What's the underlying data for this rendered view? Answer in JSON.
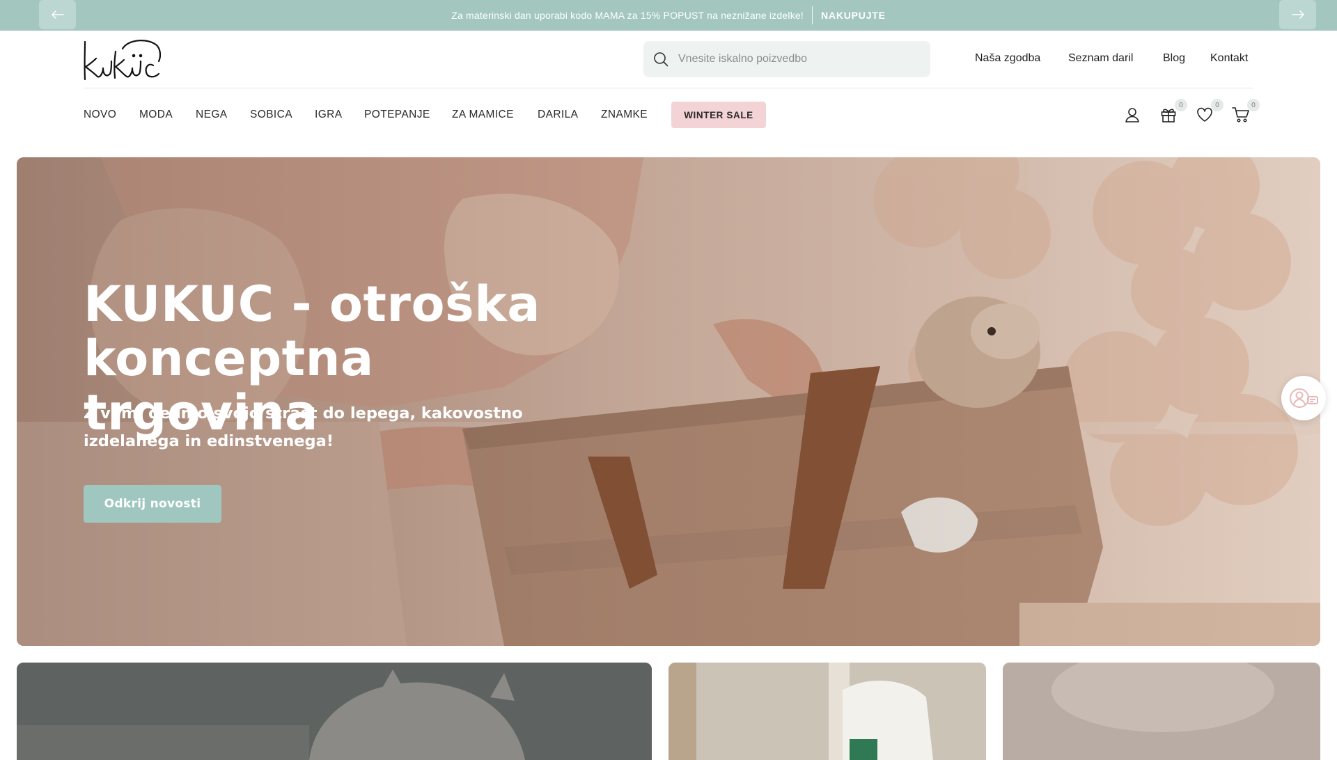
{
  "announcement": {
    "text": "Za materinski dan uporabi kodo MAMA za 15% POPUST na neznižane izdelke!",
    "cta": "NAKUPUJTE",
    "prev_icon": "arrow-left-icon",
    "next_icon": "arrow-right-icon"
  },
  "header": {
    "search_placeholder": "Vnesite iskalno poizvedbo",
    "top_links": [
      "Naša zgodba",
      "Seznam daril",
      "Blog",
      "Kontakt"
    ],
    "nav": [
      "NOVO",
      "MODA",
      "NEGA",
      "SOBICA",
      "IGRA",
      "POTEPANJE",
      "ZA MAMICE",
      "DARILA",
      "ZNAMKE"
    ],
    "sale_label": "WINTER SALE",
    "gift_count": "0",
    "wishlist_count": "0",
    "cart_count": "0"
  },
  "hero": {
    "title": "KUKUC - otroška konceptna trgovina",
    "subtitle": "Z vami delimo svojo strast do lepega, kakovostno izdelanega in edinstvenega!",
    "button": "Odkrij novosti"
  },
  "colors": {
    "brand_mint": "#a3c7bf",
    "sale_pink": "#f3d3d6",
    "text_dark": "#1f1f1f"
  }
}
